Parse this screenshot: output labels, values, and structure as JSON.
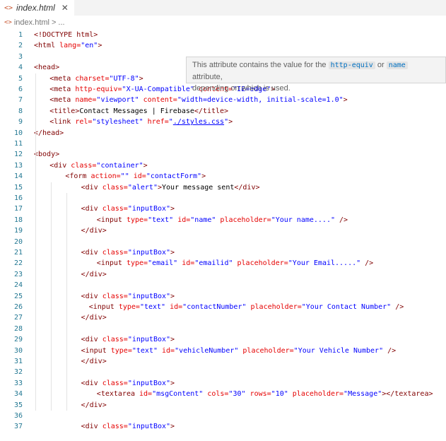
{
  "tab": {
    "icon": "html-file-icon",
    "icon_glyph": "<>",
    "name": "index.html",
    "close": "✕"
  },
  "breadcrumb": {
    "icon_glyph": "<>",
    "file": "index.html",
    "sep": ">",
    "more": "..."
  },
  "hover": {
    "pre": "This attribute contains the value for the ",
    "k1": "http-equiv",
    "mid": " or ",
    "k2": "name",
    "post": " attribute,",
    "line2": "depending on which is used."
  },
  "lines": [
    {
      "n": "1",
      "indent": 0,
      "tokens": [
        [
          "t",
          "<!DOCTYPE html>"
        ]
      ]
    },
    {
      "n": "2",
      "indent": 0,
      "tokens": [
        [
          "t",
          "<html "
        ],
        [
          "a",
          "lang="
        ],
        [
          "v",
          "\"en\""
        ],
        [
          "t",
          ">"
        ]
      ]
    },
    {
      "n": "3",
      "indent": 0,
      "tokens": []
    },
    {
      "n": "4",
      "indent": 0,
      "tokens": [
        [
          "t",
          "<head>"
        ]
      ]
    },
    {
      "n": "5",
      "indent": 1,
      "tokens": [
        [
          "t",
          "<meta "
        ],
        [
          "a",
          "charset="
        ],
        [
          "v",
          "\"UTF-8\""
        ],
        [
          "t",
          ">"
        ]
      ]
    },
    {
      "n": "6",
      "indent": 1,
      "tokens": [
        [
          "t",
          "<meta "
        ],
        [
          "a",
          "http-equiv="
        ],
        [
          "v",
          "\"X-UA-Compatible\""
        ],
        [
          "a",
          " content="
        ],
        [
          "v",
          "\"IE=edge\""
        ],
        [
          "t",
          ">"
        ]
      ]
    },
    {
      "n": "7",
      "indent": 1,
      "tokens": [
        [
          "t",
          "<meta "
        ],
        [
          "a",
          "name="
        ],
        [
          "v",
          "\"viewport\""
        ],
        [
          "a",
          " content="
        ],
        [
          "v",
          "\"width=device-width, initial-scale=1.0\""
        ],
        [
          "t",
          ">"
        ]
      ]
    },
    {
      "n": "8",
      "indent": 1,
      "tokens": [
        [
          "t",
          "<title>"
        ],
        [
          "x",
          "Contact Messages | Firebase"
        ],
        [
          "t",
          "</title>"
        ]
      ]
    },
    {
      "n": "9",
      "indent": 1,
      "tokens": [
        [
          "t",
          "<link "
        ],
        [
          "a",
          "rel="
        ],
        [
          "v",
          "\"stylesheet\""
        ],
        [
          "a",
          " href="
        ],
        [
          "v",
          "\""
        ],
        [
          "l",
          "./styles.css"
        ],
        [
          "v",
          "\""
        ],
        [
          "t",
          ">"
        ]
      ]
    },
    {
      "n": "10",
      "indent": 0,
      "tokens": [
        [
          "t",
          "</head>"
        ]
      ]
    },
    {
      "n": "11",
      "indent": 0,
      "tokens": []
    },
    {
      "n": "12",
      "indent": 0,
      "tokens": [
        [
          "t",
          "<body>"
        ]
      ]
    },
    {
      "n": "13",
      "indent": 1,
      "tokens": [
        [
          "t",
          "<div "
        ],
        [
          "a",
          "class="
        ],
        [
          "v",
          "\"container\""
        ],
        [
          "t",
          ">"
        ]
      ]
    },
    {
      "n": "14",
      "indent": 2,
      "tokens": [
        [
          "t",
          "<form "
        ],
        [
          "a",
          "action="
        ],
        [
          "v",
          "\"\""
        ],
        [
          "a",
          " id="
        ],
        [
          "v",
          "\"contactForm\""
        ],
        [
          "t",
          ">"
        ]
      ]
    },
    {
      "n": "15",
      "indent": 3,
      "tokens": [
        [
          "t",
          "<div "
        ],
        [
          "a",
          "class="
        ],
        [
          "v",
          "\"alert\""
        ],
        [
          "t",
          ">"
        ],
        [
          "x",
          "Your message sent"
        ],
        [
          "t",
          "</div>"
        ]
      ]
    },
    {
      "n": "16",
      "indent": 0,
      "tokens": []
    },
    {
      "n": "17",
      "indent": 3,
      "tokens": [
        [
          "t",
          "<div "
        ],
        [
          "a",
          "class="
        ],
        [
          "v",
          "\"inputBox\""
        ],
        [
          "t",
          ">"
        ]
      ]
    },
    {
      "n": "18",
      "indent": 4,
      "tokens": [
        [
          "t",
          "<input "
        ],
        [
          "a",
          "type="
        ],
        [
          "v",
          "\"text\""
        ],
        [
          "a",
          " id="
        ],
        [
          "v",
          "\"name\""
        ],
        [
          "a",
          " placeholder="
        ],
        [
          "v",
          "\"Your name....\""
        ],
        [
          "t",
          " />"
        ]
      ]
    },
    {
      "n": "19",
      "indent": 3,
      "tokens": [
        [
          "t",
          "</div>"
        ]
      ]
    },
    {
      "n": "20",
      "indent": 0,
      "tokens": []
    },
    {
      "n": "21",
      "indent": 3,
      "tokens": [
        [
          "t",
          "<div "
        ],
        [
          "a",
          "class="
        ],
        [
          "v",
          "\"inputBox\""
        ],
        [
          "t",
          ">"
        ]
      ]
    },
    {
      "n": "22",
      "indent": 4,
      "tokens": [
        [
          "t",
          "<input "
        ],
        [
          "a",
          "type="
        ],
        [
          "v",
          "\"email\""
        ],
        [
          "a",
          " id="
        ],
        [
          "v",
          "\"emailid\""
        ],
        [
          "a",
          " placeholder="
        ],
        [
          "v",
          "\"Your Email.....\""
        ],
        [
          "t",
          " />"
        ]
      ]
    },
    {
      "n": "23",
      "indent": 3,
      "tokens": [
        [
          "t",
          "</div>"
        ]
      ]
    },
    {
      "n": "24",
      "indent": 0,
      "tokens": []
    },
    {
      "n": "25",
      "indent": 3,
      "tokens": [
        [
          "t",
          "<div "
        ],
        [
          "a",
          "class="
        ],
        [
          "v",
          "\"inputBox\""
        ],
        [
          "t",
          ">"
        ]
      ]
    },
    {
      "n": "26",
      "indent": 3.5,
      "tokens": [
        [
          "t",
          "<input "
        ],
        [
          "a",
          "type="
        ],
        [
          "v",
          "\"text\""
        ],
        [
          "a",
          " id="
        ],
        [
          "v",
          "\"contactNumber\""
        ],
        [
          "a",
          " placeholder="
        ],
        [
          "v",
          "\"Your Contact Number\""
        ],
        [
          "t",
          " />"
        ]
      ]
    },
    {
      "n": "27",
      "indent": 3,
      "tokens": [
        [
          "t",
          "</div>"
        ]
      ]
    },
    {
      "n": "28",
      "indent": 0,
      "tokens": []
    },
    {
      "n": "29",
      "indent": 3,
      "tokens": [
        [
          "t",
          "<div "
        ],
        [
          "a",
          "class="
        ],
        [
          "v",
          "\"inputBox\""
        ],
        [
          "t",
          ">"
        ]
      ]
    },
    {
      "n": "30",
      "indent": 3,
      "tokens": [
        [
          "t",
          "<input "
        ],
        [
          "a",
          "type="
        ],
        [
          "v",
          "\"text\""
        ],
        [
          "a",
          " id="
        ],
        [
          "v",
          "\"vehicleNumber\""
        ],
        [
          "a",
          " placeholder="
        ],
        [
          "v",
          "\"Your Vehicle Number\""
        ],
        [
          "t",
          " />"
        ]
      ]
    },
    {
      "n": "31",
      "indent": 3,
      "tokens": [
        [
          "t",
          "</div>"
        ]
      ]
    },
    {
      "n": "32",
      "indent": 0,
      "tokens": []
    },
    {
      "n": "33",
      "indent": 3,
      "tokens": [
        [
          "t",
          "<div "
        ],
        [
          "a",
          "class="
        ],
        [
          "v",
          "\"inputBox\""
        ],
        [
          "t",
          ">"
        ]
      ]
    },
    {
      "n": "34",
      "indent": 4,
      "tokens": [
        [
          "t",
          "<textarea "
        ],
        [
          "a",
          "id="
        ],
        [
          "v",
          "\"msgContent\""
        ],
        [
          "a",
          " cols="
        ],
        [
          "v",
          "\"30\""
        ],
        [
          "a",
          " rows="
        ],
        [
          "v",
          "\"10\""
        ],
        [
          "a",
          " placeholder="
        ],
        [
          "v",
          "\"Message\""
        ],
        [
          "t",
          "></textarea>"
        ]
      ]
    },
    {
      "n": "35",
      "indent": 3,
      "tokens": [
        [
          "t",
          "</div>"
        ]
      ]
    },
    {
      "n": "36",
      "indent": 0,
      "tokens": []
    },
    {
      "n": "37",
      "indent": 3,
      "tokens": [
        [
          "t",
          "<div "
        ],
        [
          "a",
          "class="
        ],
        [
          "v",
          "\"inputBox\""
        ],
        [
          "t",
          ">"
        ]
      ]
    }
  ]
}
